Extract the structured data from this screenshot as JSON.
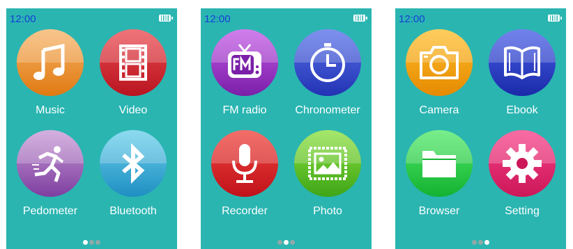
{
  "status_bar": {
    "time": "12:00"
  },
  "screens": [
    {
      "apps": [
        {
          "label": "Music",
          "icon": "music-note-icon",
          "top": "#f7b56a",
          "bottom": "#e07a12"
        },
        {
          "label": "Video",
          "icon": "film-strip-icon",
          "top": "#ec4c52",
          "bottom": "#b81520"
        },
        {
          "label": "Pedometer",
          "icon": "runner-icon",
          "top": "#c89ad6",
          "bottom": "#7e3fa0"
        },
        {
          "label": "Bluetooth",
          "icon": "bluetooth-icon",
          "top": "#6cd0ec",
          "bottom": "#1f8fc2"
        }
      ]
    },
    {
      "apps": [
        {
          "label": "FM radio",
          "icon": "fm-radio-tv-icon",
          "top": "#c45ae6",
          "bottom": "#7a1fa8"
        },
        {
          "label": "Chronometer",
          "icon": "stopwatch-icon",
          "top": "#5a72ea",
          "bottom": "#2233b3"
        },
        {
          "label": "Recorder",
          "icon": "microphone-icon",
          "top": "#f0453f",
          "bottom": "#c0121a"
        },
        {
          "label": "Photo",
          "icon": "picture-frame-icon",
          "top": "#8ce040",
          "bottom": "#3ea517"
        }
      ]
    },
    {
      "apps": [
        {
          "label": "Camera",
          "icon": "camera-icon",
          "top": "#ffc02e",
          "bottom": "#e68a00"
        },
        {
          "label": "Ebook",
          "icon": "open-book-icon",
          "top": "#4a5fe8",
          "bottom": "#1a2aa8"
        },
        {
          "label": "Browser",
          "icon": "folder-icon",
          "top": "#52ea6a",
          "bottom": "#14b232"
        },
        {
          "label": "Setting",
          "icon": "gear-icon",
          "top": "#f7418a",
          "bottom": "#cc1858"
        }
      ]
    }
  ],
  "page_indicator": {
    "count": 3
  },
  "colors": {
    "screen_background": "#2ab5b1",
    "clock_text": "#1740d6",
    "dot_inactive": "#8fa9aa",
    "dot_active": "#ffffff"
  }
}
